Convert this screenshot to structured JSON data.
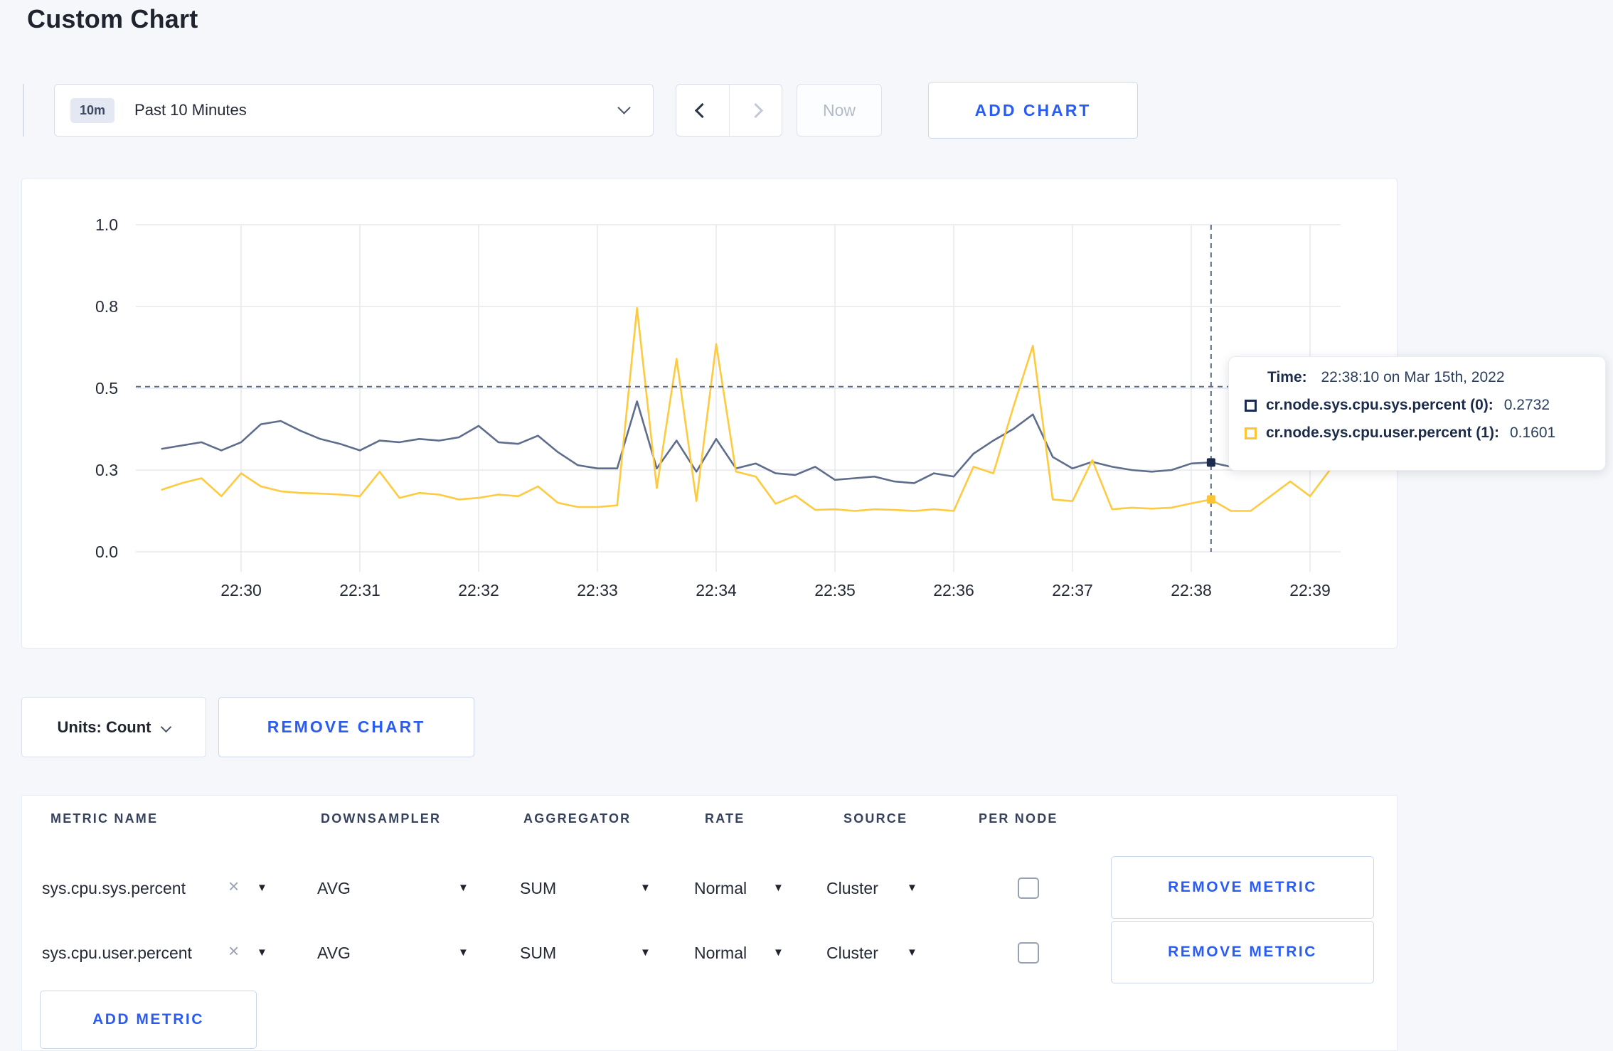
{
  "page": {
    "title": "Custom Chart"
  },
  "toolbar": {
    "time_range": {
      "badge": "10m",
      "label": "Past 10 Minutes"
    },
    "now_label": "Now",
    "add_chart_label": "ADD CHART"
  },
  "icons": {
    "close": "×",
    "caret_down": "▼"
  },
  "tooltip": {
    "time_label": "Time:",
    "time_value": "22:38:10 on Mar 15th, 2022",
    "entries": [
      {
        "label": "cr.node.sys.cpu.sys.percent (0):",
        "value": "0.2732",
        "color": "#1b2a4e"
      },
      {
        "label": "cr.node.sys.cpu.user.percent (1):",
        "value": "0.1601",
        "color": "#ffc531"
      }
    ]
  },
  "chart_footer": {
    "units_label": "Units: Count",
    "remove_chart_label": "REMOVE CHART"
  },
  "metrics_table": {
    "headers": [
      "METRIC NAME",
      "DOWNSAMPLER",
      "AGGREGATOR",
      "RATE",
      "SOURCE",
      "PER NODE"
    ],
    "rows": [
      {
        "metric_name": "sys.cpu.sys.percent",
        "downsampler": "AVG",
        "aggregator": "SUM",
        "rate": "Normal",
        "source": "Cluster",
        "per_node_checked": false,
        "remove_label": "REMOVE METRIC"
      },
      {
        "metric_name": "sys.cpu.user.percent",
        "downsampler": "AVG",
        "aggregator": "SUM",
        "rate": "Normal",
        "source": "Cluster",
        "per_node_checked": false,
        "remove_label": "REMOVE METRIC"
      }
    ],
    "add_metric_label": "ADD METRIC"
  },
  "chart_data": {
    "type": "line",
    "title": "",
    "xlabel": "",
    "ylabel": "",
    "ylim": [
      0,
      1
    ],
    "grid": true,
    "xticks": [
      "22:30",
      "22:31",
      "22:32",
      "22:33",
      "22:34",
      "22:35",
      "22:36",
      "22:37",
      "22:38",
      "22:39"
    ],
    "ytick_values": [
      0,
      0.25,
      0.5,
      0.75,
      1
    ],
    "ytick_labels": [
      "0.0",
      "0.3",
      "0.5",
      "0.8",
      "1.0"
    ],
    "x": [
      "22:29:20",
      "22:29:30",
      "22:29:40",
      "22:29:50",
      "22:30:00",
      "22:30:10",
      "22:30:20",
      "22:30:30",
      "22:30:40",
      "22:30:50",
      "22:31:00",
      "22:31:10",
      "22:31:20",
      "22:31:30",
      "22:31:40",
      "22:31:50",
      "22:32:00",
      "22:32:10",
      "22:32:20",
      "22:32:30",
      "22:32:40",
      "22:32:50",
      "22:33:00",
      "22:33:10",
      "22:33:20",
      "22:33:30",
      "22:33:40",
      "22:33:50",
      "22:34:00",
      "22:34:10",
      "22:34:20",
      "22:34:30",
      "22:34:40",
      "22:34:50",
      "22:35:00",
      "22:35:10",
      "22:35:20",
      "22:35:30",
      "22:35:40",
      "22:35:50",
      "22:36:00",
      "22:36:10",
      "22:36:20",
      "22:36:30",
      "22:36:40",
      "22:36:50",
      "22:37:00",
      "22:37:10",
      "22:37:20",
      "22:37:30",
      "22:37:40",
      "22:37:50",
      "22:38:00",
      "22:38:10",
      "22:38:20",
      "22:38:30",
      "22:38:40",
      "22:38:50",
      "22:39:00",
      "22:39:10"
    ],
    "series": [
      {
        "name": "cr.node.sys.cpu.sys.percent",
        "color": "#5f6d8c",
        "values": [
          0.315,
          0.325,
          0.335,
          0.31,
          0.335,
          0.39,
          0.4,
          0.37,
          0.345,
          0.33,
          0.31,
          0.34,
          0.335,
          0.345,
          0.34,
          0.35,
          0.385,
          0.335,
          0.33,
          0.355,
          0.305,
          0.265,
          0.255,
          0.255,
          0.46,
          0.255,
          0.34,
          0.245,
          0.345,
          0.255,
          0.27,
          0.24,
          0.235,
          0.26,
          0.22,
          0.225,
          0.23,
          0.215,
          0.21,
          0.24,
          0.23,
          0.3,
          0.34,
          0.375,
          0.42,
          0.29,
          0.255,
          0.275,
          0.26,
          0.25,
          0.245,
          0.25,
          0.27,
          0.2732,
          0.26,
          0.28,
          0.295,
          0.29,
          0.295,
          0.3
        ]
      },
      {
        "name": "cr.node.sys.cpu.user.percent",
        "color": "#fdca40",
        "values": [
          0.19,
          0.21,
          0.225,
          0.17,
          0.24,
          0.2,
          0.185,
          0.18,
          0.178,
          0.175,
          0.17,
          0.245,
          0.165,
          0.18,
          0.175,
          0.16,
          0.165,
          0.175,
          0.17,
          0.2,
          0.15,
          0.137,
          0.137,
          0.142,
          0.745,
          0.195,
          0.59,
          0.155,
          0.635,
          0.245,
          0.23,
          0.147,
          0.172,
          0.128,
          0.13,
          0.125,
          0.13,
          0.128,
          0.125,
          0.13,
          0.125,
          0.26,
          0.24,
          0.44,
          0.63,
          0.16,
          0.155,
          0.28,
          0.13,
          0.135,
          0.132,
          0.135,
          0.148,
          0.1601,
          0.125,
          0.125,
          0.17,
          0.215,
          0.17,
          0.25
        ]
      }
    ],
    "crosshair": {
      "time": "22:38:10",
      "y_value": 0.505,
      "markers": [
        {
          "series": 0,
          "value": 0.2732,
          "color": "#1b2a4e"
        },
        {
          "series": 1,
          "value": 0.1601,
          "color": "#ffc531"
        }
      ]
    },
    "legend_position": "tooltip"
  }
}
